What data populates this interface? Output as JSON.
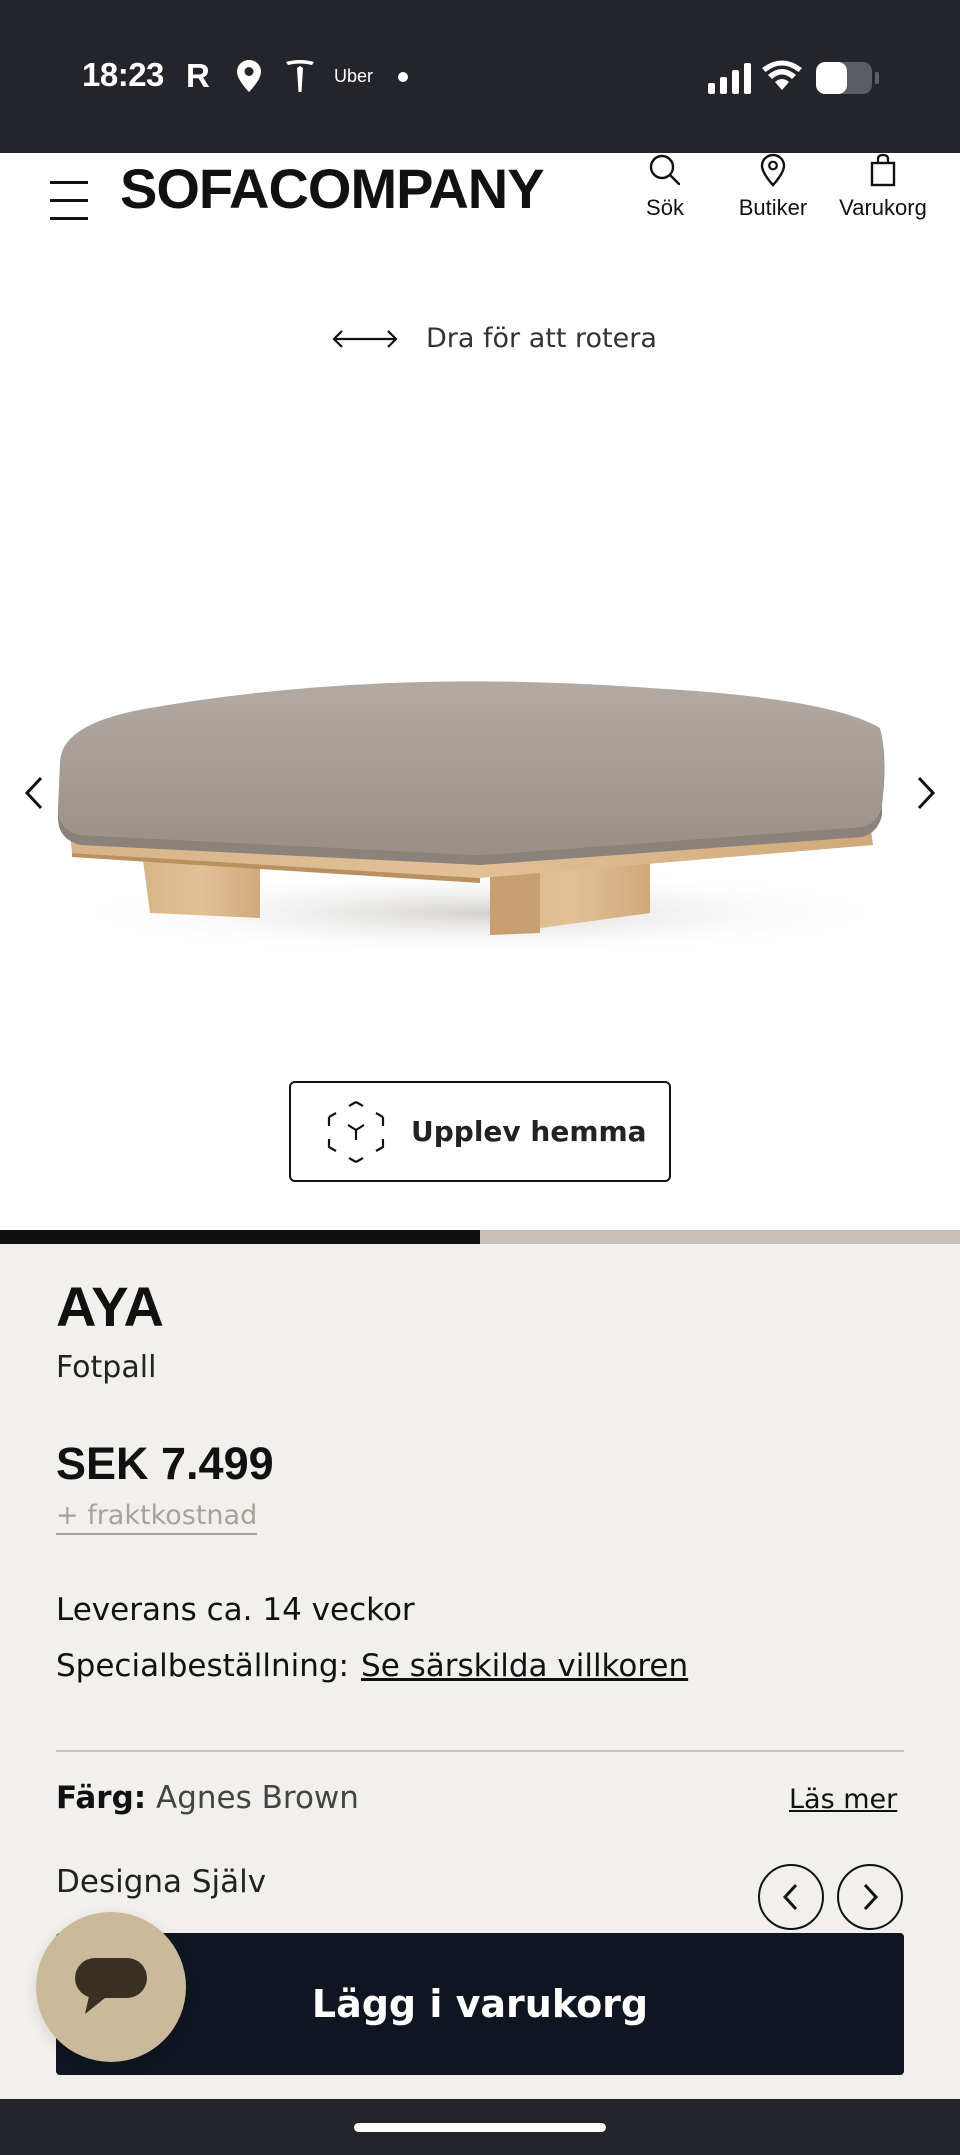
{
  "status_bar": {
    "time": "18:23",
    "app_icons": [
      "r-icon",
      "location-pin-icon",
      "tesla-icon",
      "uber-icon"
    ],
    "uber_label": "Uber",
    "r_label": "R",
    "battery_level": 0.55
  },
  "header": {
    "logo": "SOFACOMPANY",
    "nav": {
      "search": "Sök",
      "stores": "Butiker",
      "cart": "Varukorg"
    }
  },
  "viewer": {
    "rotate_hint": "Dra för att rotera",
    "ar_button": "Upplev hemma",
    "gallery_progress": 0.5
  },
  "product": {
    "name": "AYA",
    "type": "Fotpall",
    "price": "SEK 7.499",
    "shipping": "+ fraktkostnad",
    "delivery": "Leverans ca. 14 veckor",
    "special_label": "Specialbeställning:",
    "special_link": "Se särskilda villkoren",
    "color_label": "Färg:",
    "color_value": "Agnes Brown",
    "read_more": "Läs mer",
    "design_yourself": "Designa Själv"
  },
  "cta": {
    "add_to_cart": "Lägg i varukorg"
  },
  "colors": {
    "background": "#f2f0ec",
    "cta": "#0f1621",
    "chat": "#cbb99c",
    "progress_track": "#c9bfb6"
  }
}
